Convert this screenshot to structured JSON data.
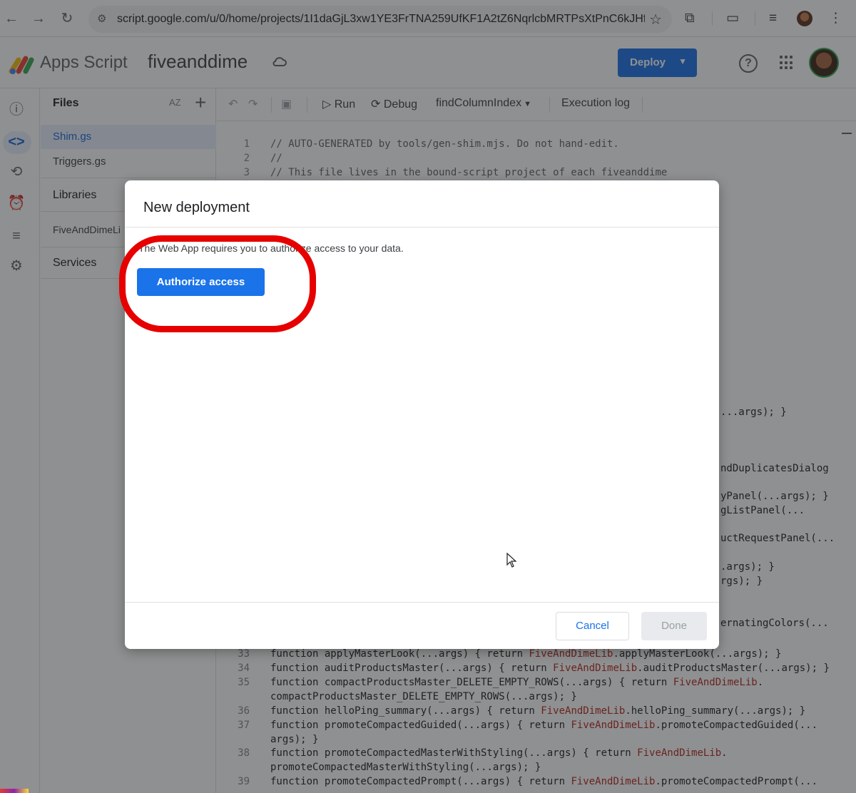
{
  "browser": {
    "url": "script.google.com/u/0/home/projects/1I1daGjL3xw1YE3FrTNA259UfKF1A2tZ6NqrlcbMRTPsXtPnC6kJHfDd...",
    "icons": [
      "back-arrow-icon",
      "forward-arrow-icon",
      "reload-icon",
      "site-settings-icon",
      "star-icon",
      "extensions-icon",
      "tab-search-icon",
      "media-queue-icon",
      "profile-icon",
      "more-vert-icon"
    ]
  },
  "header": {
    "app_name": "Apps Script",
    "project_name": "fiveanddime",
    "deploy_label": "Deploy"
  },
  "files_panel": {
    "title": "Files",
    "sort_label": "AZ",
    "files": [
      {
        "label": "Shim.gs",
        "active": true
      },
      {
        "label": "Triggers.gs",
        "active": false
      }
    ],
    "libraries_label": "Libraries",
    "library_item": "FiveAndDimeLi",
    "services_label": "Services"
  },
  "toolbar": {
    "run_label": "Run",
    "debug_label": "Debug",
    "function_name": "findColumnIndex",
    "execution_log_label": "Execution log"
  },
  "editor": {
    "top_lines": [
      {
        "n": "1",
        "text": "// AUTO-GENERATED by tools/gen-shim.mjs. Do not hand-edit."
      },
      {
        "n": "2",
        "text": "//"
      },
      {
        "n": "3",
        "text": "// This file lives in the bound-script project of each fiveanddime"
      }
    ],
    "right_fragments": [
      "...args); }",
      "ndDuplicatesDialog",
      "yPanel(...args); }",
      "gListPanel(...",
      "uctRequestPanel(...",
      ".args); }",
      "rgs); }",
      "ernatingColors(..."
    ],
    "bottom_lines": [
      {
        "n": "33",
        "pre": "function applyMasterLook(...args) { return ",
        "lib": "FiveAndDimeLib",
        "post": ".applyMasterLook(...args); }"
      },
      {
        "n": "34",
        "pre": "function auditProductsMaster(...args) { return ",
        "lib": "FiveAndDimeLib",
        "post": ".auditProductsMaster(...args); }"
      },
      {
        "n": "35",
        "pre": "function compactProductsMaster_DELETE_EMPTY_ROWS(...args) { return ",
        "lib": "FiveAndDimeLib",
        "post": "."
      },
      {
        "n": "",
        "pre": "compactProductsMaster_DELETE_EMPTY_ROWS(...args); }",
        "lib": "",
        "post": ""
      },
      {
        "n": "36",
        "pre": "function helloPing_summary(...args) { return ",
        "lib": "FiveAndDimeLib",
        "post": ".helloPing_summary(...args); }"
      },
      {
        "n": "37",
        "pre": "function promoteCompactedGuided(...args) { return ",
        "lib": "FiveAndDimeLib",
        "post": ".promoteCompactedGuided(..."
      },
      {
        "n": "",
        "pre": "args); }",
        "lib": "",
        "post": ""
      },
      {
        "n": "38",
        "pre": "function promoteCompactedMasterWithStyling(...args) { return ",
        "lib": "FiveAndDimeLib",
        "post": "."
      },
      {
        "n": "",
        "pre": "promoteCompactedMasterWithStyling(...args); }",
        "lib": "",
        "post": ""
      },
      {
        "n": "39",
        "pre": "function promoteCompactedPrompt(...args) { return ",
        "lib": "FiveAndDimeLib",
        "post": ".promoteCompactedPrompt(..."
      }
    ]
  },
  "dialog": {
    "title": "New deployment",
    "message": "The Web App requires you to authorize access to your data.",
    "authorize_label": "Authorize access",
    "cancel_label": "Cancel",
    "done_label": "Done"
  },
  "colors": {
    "accent": "#1a73e8",
    "annotation_ring": "#e60000",
    "library_name": "#b3261e"
  }
}
